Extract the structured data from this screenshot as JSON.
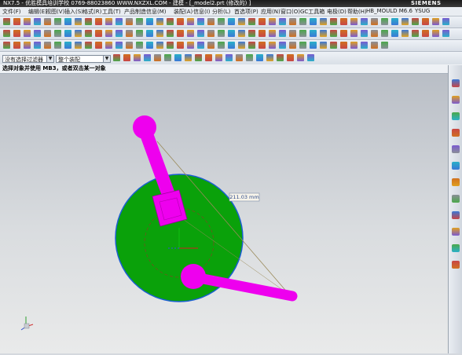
{
  "window": {
    "title": "NX7.5 - 优胜模具培训学校   0769-88023860   WWW.NXZXL.COM - 建模 - [_model2.prt (修改的) ]",
    "brand": "SIEMENS"
  },
  "menu": {
    "items": [
      "文件(F)",
      "编辑(E)",
      "视图(V)",
      "插入(S)",
      "格式(R)",
      "工具(T)",
      "产品制造信息(M)",
      "装配(A)",
      "信息(I)",
      "分析(L)",
      "首选项(P)",
      "应用(N)",
      "窗口(O)",
      "GC工具箱",
      "电极(D)",
      "帮助(H)",
      "HB_MOULD M6.6",
      "YSUG"
    ]
  },
  "selection_bar": {
    "filter_value": "没有选择过滤器",
    "scope_value": "整个装配"
  },
  "cue_line": {
    "text": "选择对象并使用 MB3，或者双击某一对象"
  },
  "viewport": {
    "dimension_label": "211.03 mm",
    "colors": {
      "disc": "#0aa10a",
      "disc_edge": "#1a5fd1",
      "arm": "#ee00ee",
      "dimension": "#9a8a5a"
    }
  },
  "icons": {
    "right_toolbar": [
      "part-navigator-icon",
      "assembly-navigator-icon",
      "constraint-navigator-icon",
      "reuse-library-icon",
      "hd3d-tools-icon",
      "web-browser-icon",
      "history-icon",
      "system-materials-icon",
      "process-studio-icon",
      "manufacturing-wizards-icon",
      "roles-icon",
      "system-scenes-icon"
    ]
  }
}
